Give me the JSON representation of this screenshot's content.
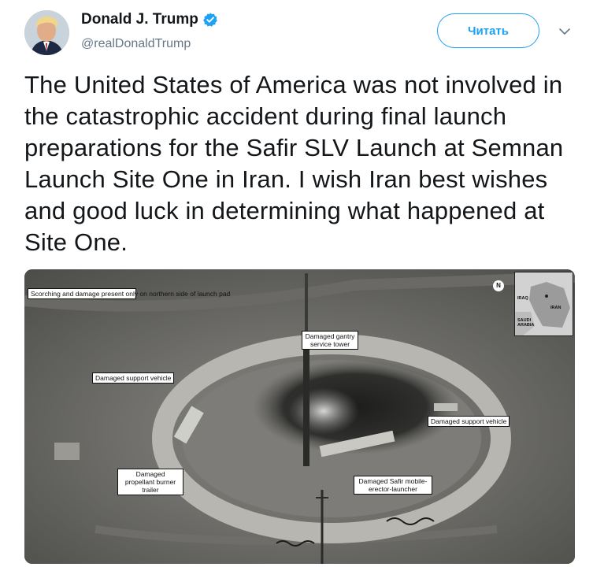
{
  "author": {
    "name": "Donald J. Trump",
    "handle": "@realDonaldTrump",
    "verified_icon": "verified-badge-icon",
    "avatar_icon": "profile-photo"
  },
  "follow_button": {
    "label": "Читать"
  },
  "menu_icon": "chevron-down-icon",
  "tweet": {
    "text": "The United States of America was not involved in the catastrophic accident during final launch preparations for the Safir SLV Launch at Semnan Launch Site One in Iran. I wish Iran best wishes and good luck in determining what happened at Site One."
  },
  "photo": {
    "labels": {
      "scorching": "Scorching and damage present only on northern side of launch pad",
      "gantry": "Damaged gantry service tower",
      "support_left": "Damaged support vehicle",
      "support_right": "Damaged support vehicle",
      "trailer": "Damaged propellant burner trailer",
      "launcher": "Damaged Safir mobile-erector-launcher"
    },
    "north_marker": "N",
    "inset_map": {
      "labels": [
        "IRAQ",
        "SAUDI ARABIA",
        "IRAN"
      ]
    }
  },
  "colors": {
    "accent": "#1da1f2",
    "text": "#14171a",
    "muted": "#657786"
  }
}
